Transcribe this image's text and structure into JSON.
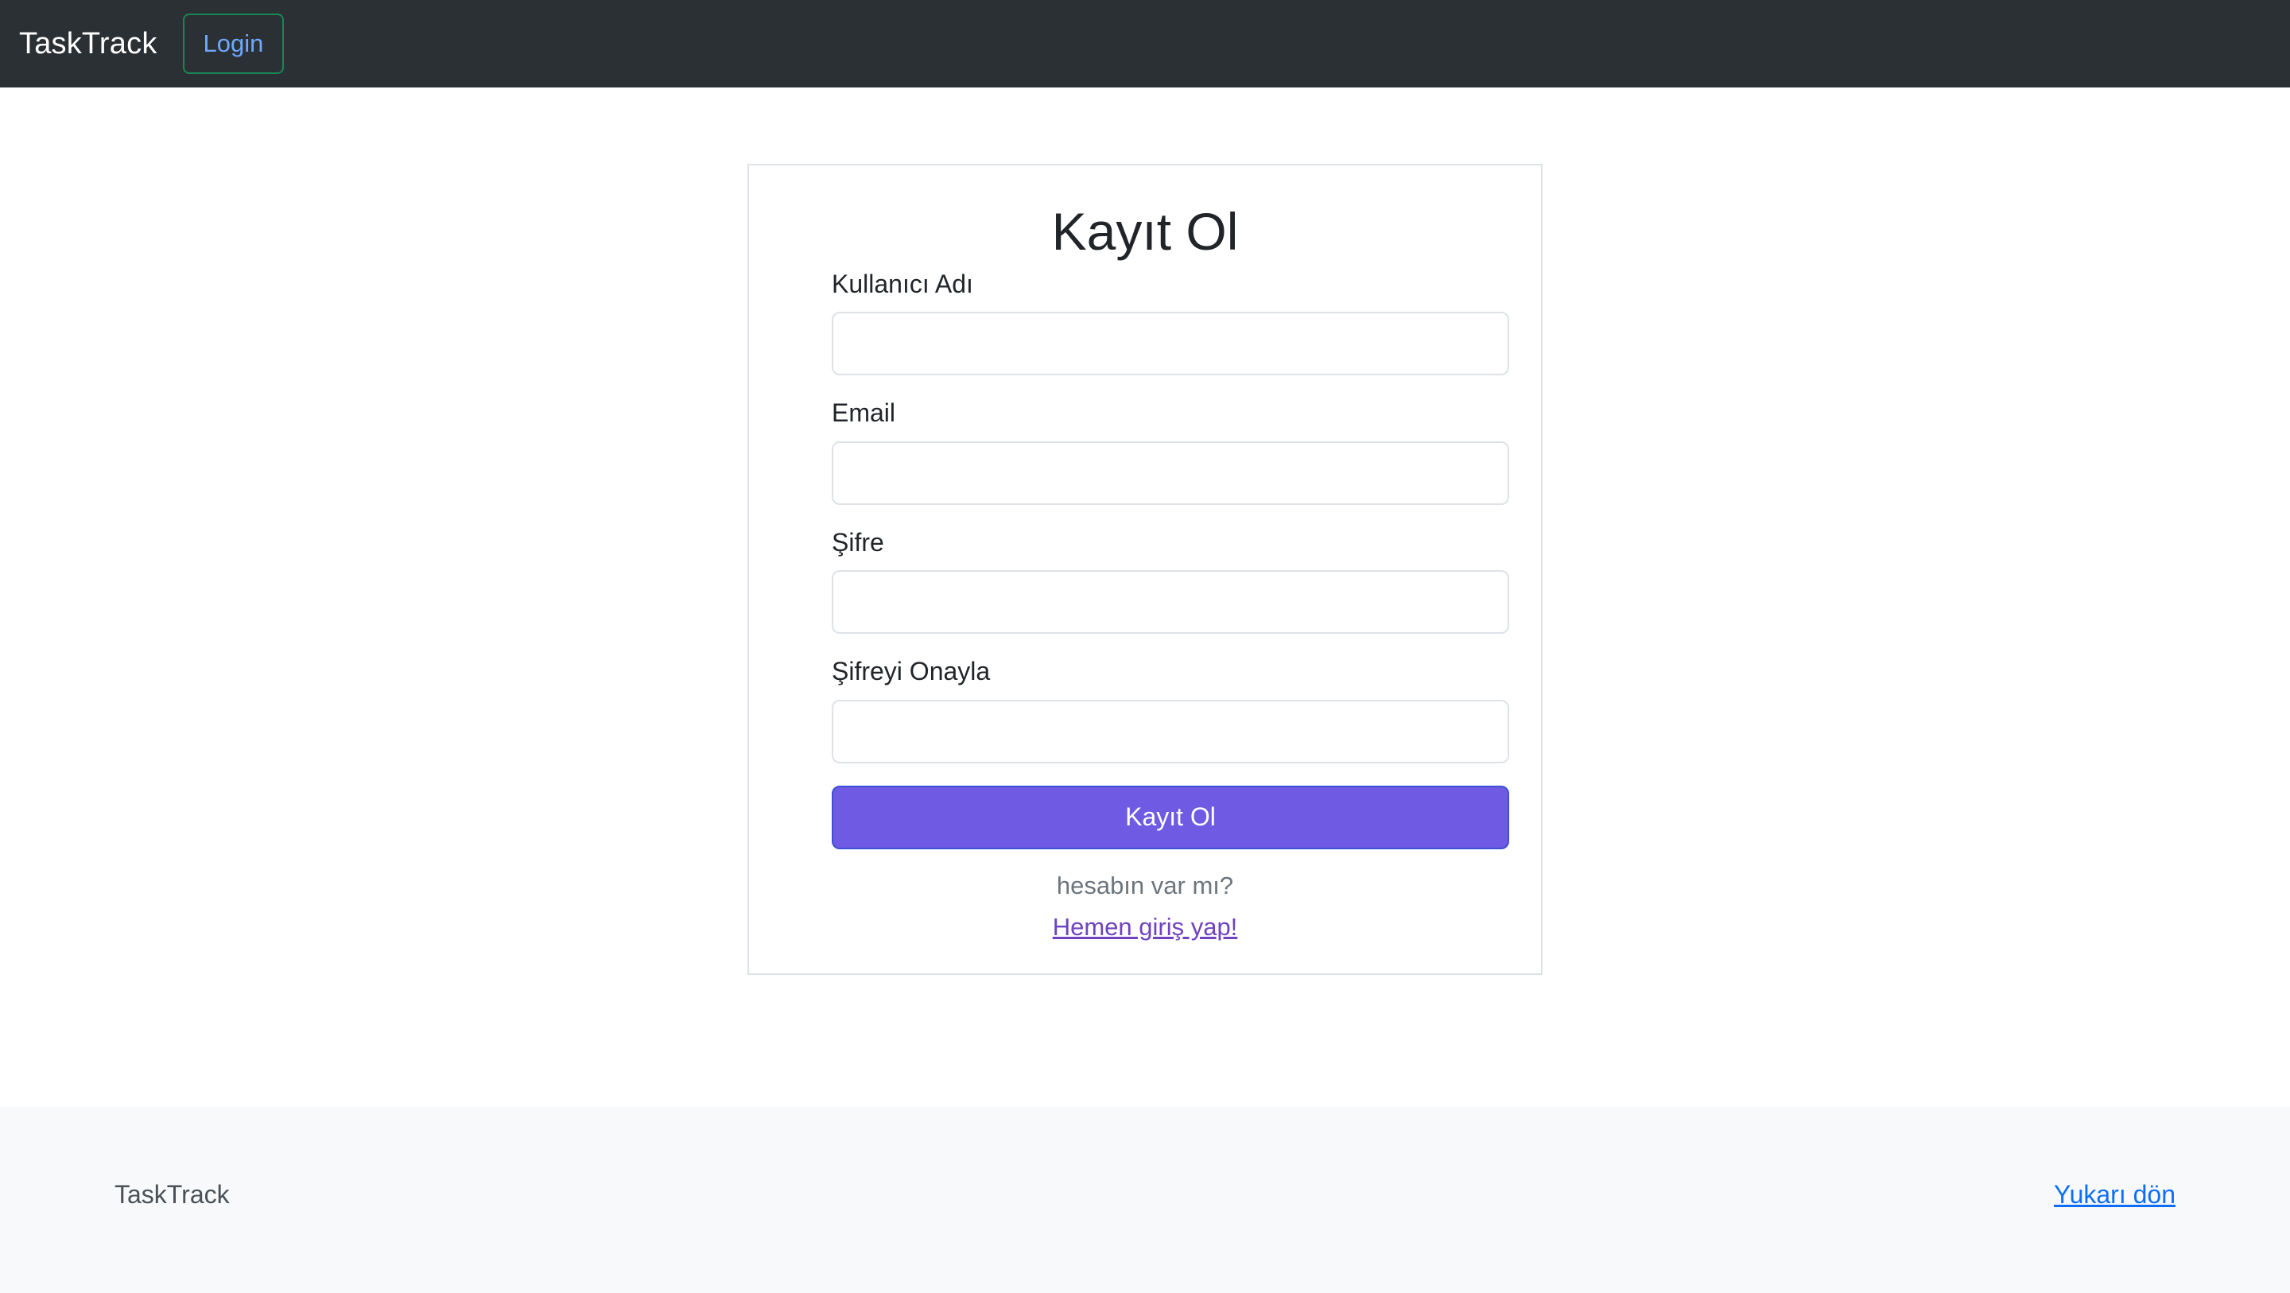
{
  "navbar": {
    "brand": "TaskTrack",
    "login_button": "Login"
  },
  "register_form": {
    "title": "Kayıt Ol",
    "fields": [
      {
        "label": "Kullanıcı Adı",
        "value": "",
        "placeholder": ""
      },
      {
        "label": "Email",
        "value": "",
        "placeholder": ""
      },
      {
        "label": "Şifre",
        "value": "",
        "placeholder": ""
      },
      {
        "label": "Şifreyi Onayla",
        "value": "",
        "placeholder": ""
      }
    ],
    "submit_label": "Kayıt Ol",
    "account_prompt": "hesabın var mı?",
    "login_link": "Hemen giriş yap!"
  },
  "footer": {
    "brand": "TaskTrack",
    "back_to_top": "Yukarı dön"
  },
  "colors": {
    "navbar_bg": "#2b3035",
    "login_border": "#198754",
    "login_text": "#6ea8fe",
    "submit_bg": "#6f5ae3",
    "link_purple": "#6f42c1",
    "footer_link": "#0d6efd",
    "footer_bg": "#f8f9fa"
  }
}
